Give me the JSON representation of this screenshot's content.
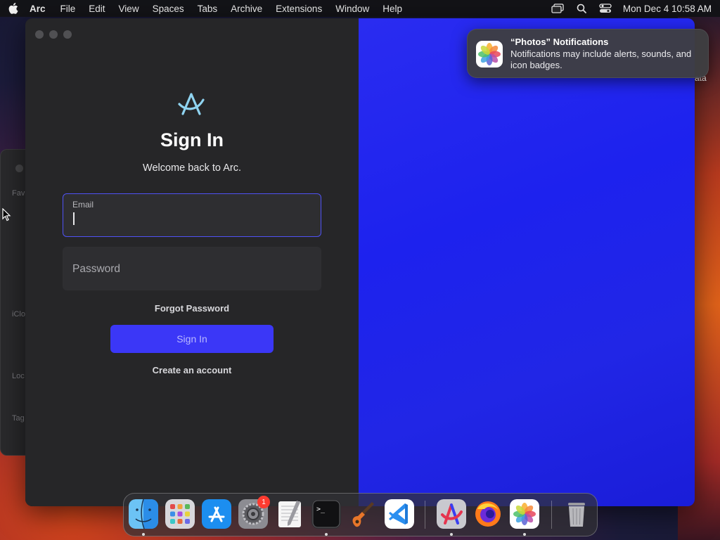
{
  "menubar": {
    "app_name": "Arc",
    "items": [
      "File",
      "Edit",
      "View",
      "Spaces",
      "Tabs",
      "Archive",
      "Extensions",
      "Window",
      "Help"
    ],
    "clock": "Mon Dec 4  10:58 AM",
    "status_icons": [
      "screen-mirroring-icon",
      "search-icon",
      "control-center-icon"
    ]
  },
  "finder_sidebar": {
    "labels": [
      "Fav",
      "iClo",
      "Loc",
      "Tag"
    ]
  },
  "signin": {
    "title": "Sign In",
    "subtitle": "Welcome back to Arc.",
    "email_label": "Email",
    "email_value": "",
    "password_placeholder": "Password",
    "forgot_label": "Forgot Password",
    "signin_button": "Sign In",
    "create_account": "Create an account"
  },
  "partial_text": "ata",
  "notification": {
    "title": "“Photos” Notifications",
    "body": "Notifications may include alerts, sounds, and icon badges."
  },
  "dock": {
    "apps": [
      "Finder",
      "Launchpad",
      "App Store",
      "System Settings",
      "TextEdit",
      "Terminal",
      "GarageBand",
      "Visual Studio Code",
      "Arc",
      "Firefox",
      "Photos",
      "Trash"
    ],
    "settings_badge": "1"
  },
  "colors": {
    "accent": "#3b37f7",
    "window_bg": "#262628",
    "right_panel": "#1f24ee"
  }
}
